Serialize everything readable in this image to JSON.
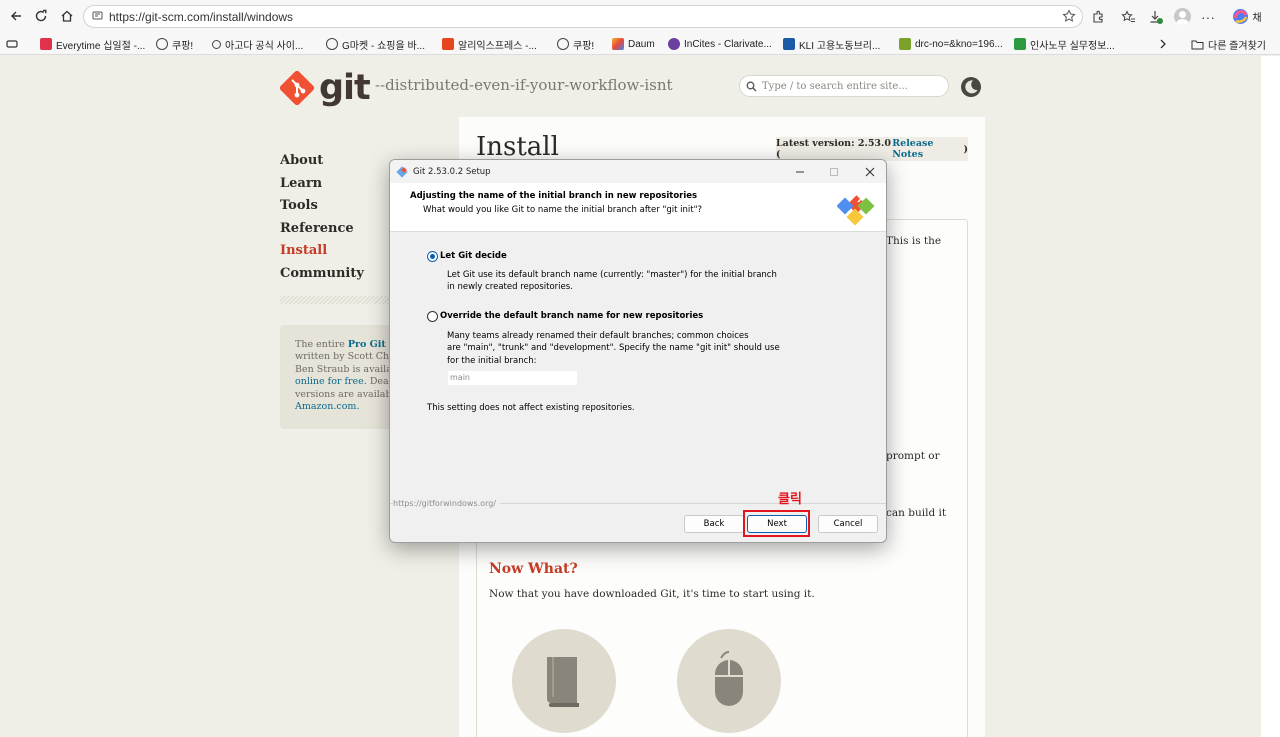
{
  "browser": {
    "url": "https://git-scm.com/install/windows",
    "profile_label": "채",
    "bookmarks": [
      "Everytime 십일절 -...",
      "쿠팡!",
      "아고다 공식 사이...",
      "G마켓 - 쇼핑을 바...",
      "알리익스프레스 -...",
      "쿠팡!",
      "Daum",
      "InCites - Clarivate...",
      "KLI 고용노동브리...",
      "drc-no=&kno=196...",
      "인사노무 실무정보...",
      "다른 즐겨찾기"
    ]
  },
  "site": {
    "logo_text": "git",
    "tagline": "--distributed-even-if-your-workflow-isnt",
    "search_placeholder": "Type / to search entire site...",
    "nav": [
      "About",
      "Learn",
      "Tools",
      "Reference",
      "Install",
      "Community"
    ],
    "active_nav": "Install",
    "progit": {
      "l1a": "The entire ",
      "l1b": "Pro Git bo",
      "l2": "written by Scott Chac",
      "l3": "Ben Straub is available",
      "l4a": "online for free.",
      "l4b": " Dead t",
      "l5": "versions are available",
      "l6": "Amazon.com."
    },
    "page_title": "Install",
    "latest_version_label": "Latest version: 2.53.0 (",
    "release_notes": "Release Notes",
    "latest_version_close": ")",
    "peek_text_1": "This is the",
    "peek_text_2": "prompt or",
    "peek_text_3": "can build it",
    "now_what_heading": "Now What?",
    "now_what_text": "Now that you have downloaded Git, it's time to start using it."
  },
  "dialog": {
    "title": "Git 2.53.0.2 Setup",
    "header_title": "Adjusting the name of the initial branch in new repositories",
    "header_subtitle": "What would you like Git to name the initial branch after \"git init\"?",
    "option1_label": "Let Git decide",
    "option1_desc_1": "Let Git use its default branch name (currently: \"master\") for the initial branch",
    "option1_desc_2": "in newly created repositories.",
    "option2_label": "Override the default branch name for new repositories",
    "option2_desc_1": "Many teams already renamed their default branches; common choices",
    "option2_desc_2": "are \"main\", \"trunk\" and \"development\". Specify the name \"git init\" should use",
    "option2_desc_3": "for the initial branch:",
    "branch_input_value": "main",
    "note": "This setting does not affect existing repositories.",
    "footer_url": "https://gitforwindows.org/",
    "back_label": "Back",
    "next_label": "Next",
    "cancel_label": "Cancel",
    "selected_option": "Let Git decide"
  },
  "annotation": {
    "label": "클릭",
    "color": "#e3161f"
  },
  "colors": {
    "git_orange": "#f05133",
    "git_red": "#c63b25",
    "link_blue": "#0a6b8e",
    "windows_blue": "#0a5fb4"
  }
}
